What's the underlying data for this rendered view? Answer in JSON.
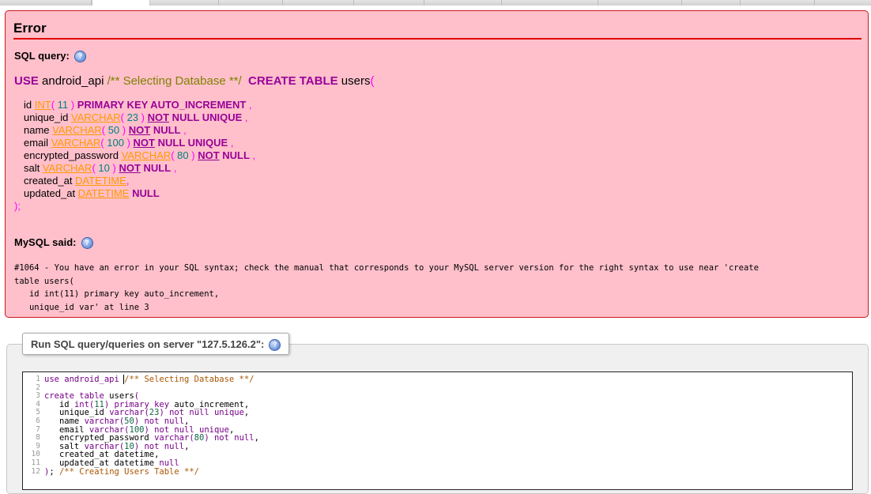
{
  "error": {
    "title": "Error",
    "sql_query_label": "SQL query:",
    "mysql_said_label": "MySQL said:",
    "sql_head": {
      "use": "USE",
      "db": " android_api ",
      "comment": "/** Selecting Database **/",
      "create": "CREATE TABLE",
      "table": " users",
      "open": "("
    },
    "columns": [
      {
        "name": "id ",
        "type": "INT",
        "len": " 11 ",
        "mods": "PRIMARY KEY AUTO_INCREMENT"
      },
      {
        "name": "unique_id ",
        "type": "VARCHAR",
        "len": " 23 ",
        "not": "NOT",
        "mods": " NULL UNIQUE"
      },
      {
        "name": "name ",
        "type": "VARCHAR",
        "len": " 50 ",
        "not": "NOT",
        "mods": " NULL"
      },
      {
        "name": "email ",
        "type": "VARCHAR",
        "len": " 100 ",
        "not": "NOT",
        "mods": " NULL UNIQUE"
      },
      {
        "name": "encrypted_password ",
        "type": "VARCHAR",
        "len": " 80 ",
        "not": "NOT",
        "mods": " NULL"
      },
      {
        "name": "salt ",
        "type": "VARCHAR",
        "len": " 10 ",
        "not": "NOT",
        "mods": " NULL"
      },
      {
        "name": "created_at ",
        "type": "DATETIME"
      },
      {
        "name": "updated_at ",
        "type": "DATETIME",
        "mods": "NULL"
      }
    ],
    "sql_close": ");",
    "message_lines": [
      "#1064 - You have an error in your SQL syntax; check the manual that corresponds to your MySQL server version for the right syntax to use near 'create",
      "table users(",
      "   id int(11) primary key auto_increment,",
      "   unique_id var' at line 3"
    ]
  },
  "query_panel": {
    "legend": "Run SQL query/queries on server \"127.5.126.2\":",
    "line_numbers": [
      "1",
      "2",
      "3",
      "4",
      "5",
      "6",
      "7",
      "8",
      "9",
      "10",
      "11",
      "12"
    ],
    "code": {
      "l1a": "use android_api ",
      "l1b": "/** Selecting Database **/",
      "l3a": "create table",
      "l3b": " users",
      "l3c": "(",
      "l4": [
        "   id ",
        "int",
        "(",
        "11",
        ")",
        " primary key",
        " auto_increment,"
      ],
      "l5": [
        "   unique_id ",
        "varchar",
        "(",
        "23",
        ")",
        " not null unique",
        ","
      ],
      "l6": [
        "   name ",
        "varchar",
        "(",
        "50",
        ")",
        " not null",
        ","
      ],
      "l7": [
        "   email ",
        "varchar",
        "(",
        "100",
        ")",
        " not null unique",
        ","
      ],
      "l8": [
        "   encrypted_password ",
        "varchar",
        "(",
        "80",
        ")",
        " not null",
        ","
      ],
      "l9": [
        "   salt ",
        "varchar",
        "(",
        "10",
        ")",
        " not null",
        ","
      ],
      "l10": [
        "   created_at datetime,"
      ],
      "l11": [
        "   updated_at datetime ",
        "null"
      ],
      "l12a": ")",
      "l12b": "; ",
      "l12c": "/** Creating Users Table **/"
    }
  }
}
